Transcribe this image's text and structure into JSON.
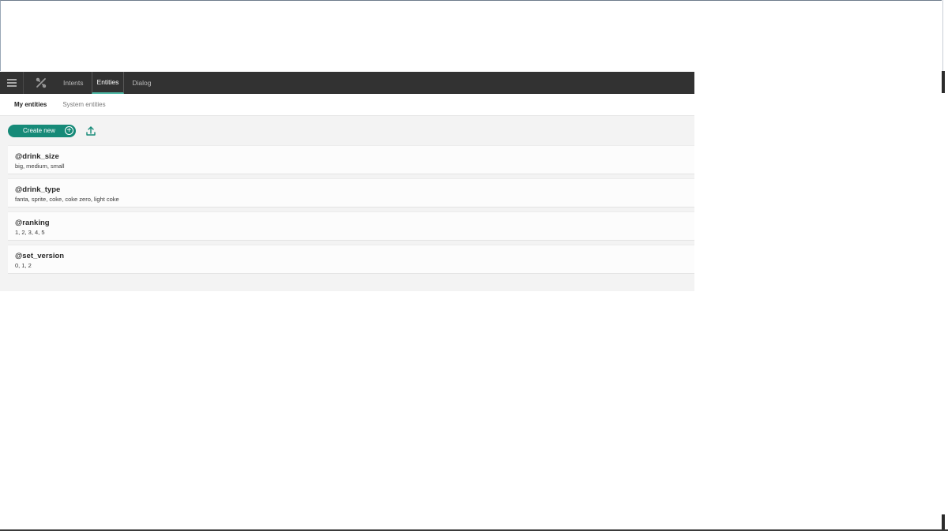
{
  "navbar": {
    "tabs": [
      {
        "label": "Intents",
        "active": false
      },
      {
        "label": "Entities",
        "active": true
      },
      {
        "label": "Dialog",
        "active": false
      }
    ]
  },
  "subnav": {
    "tabs": [
      {
        "label": "My entities",
        "active": true
      },
      {
        "label": "System entities",
        "active": false
      }
    ]
  },
  "actions": {
    "create_label": "Create new"
  },
  "entities": [
    {
      "name": "@drink_size",
      "values": "big,  medium,  small"
    },
    {
      "name": "@drink_type",
      "values": "fanta,  sprite,  coke,  coke zero,  light coke"
    },
    {
      "name": "@ranking",
      "values": "1,  2,  3,  4,  5"
    },
    {
      "name": "@set_version",
      "values": "0,  1,  2"
    }
  ],
  "colors": {
    "navbar_bg": "#323232",
    "accent": "#168a78",
    "active_underline": "#4fb8a6"
  },
  "icons": [
    "menu-icon",
    "tools-icon",
    "plus-circle-icon",
    "upload-icon"
  ]
}
